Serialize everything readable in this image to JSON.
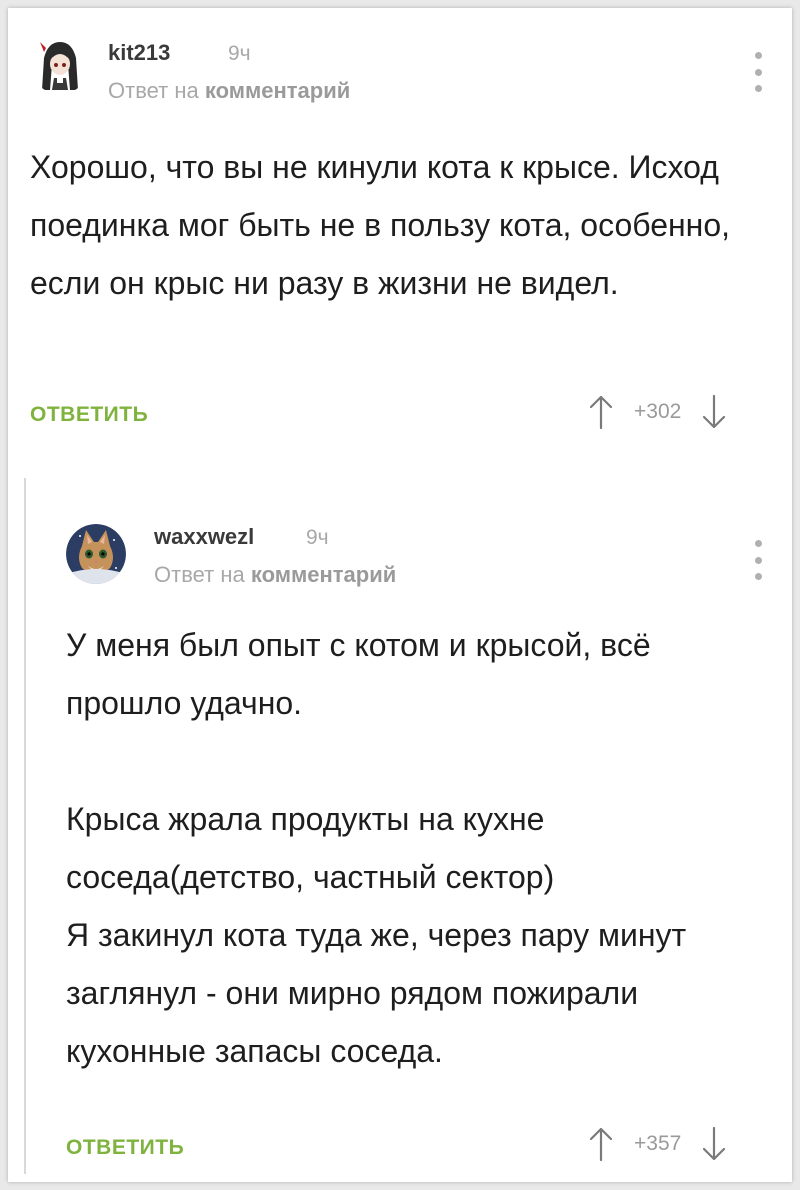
{
  "comments": [
    {
      "username": "kit213",
      "time": "9ч",
      "reply_prefix": "Ответ на",
      "reply_target": "комментарий",
      "paragraphs": [
        "Хорошо, что вы не кинули кота к крысе. Исход поединка мог быть не в пользу кота, особенно, если он крыс ни разу в жизни не видел."
      ],
      "reply_label": "ОТВЕТИТЬ",
      "score": "+302",
      "avatar_icon": "anime-girl-avatar"
    },
    {
      "username": "waxxwezl",
      "time": "9ч",
      "reply_prefix": "Ответ на",
      "reply_target": "комментарий",
      "paragraphs": [
        "У меня был опыт с котом и крысой, всё прошло удачно.",
        "Крыса жрала продукты на кухне соседа(детство, частный сектор)\nЯ закинул кота туда же, через пару минут заглянул - они мирно рядом пожирали кухонные запасы соседа."
      ],
      "reply_label": "ОТВЕТИТЬ",
      "score": "+357",
      "avatar_icon": "cat-in-space-avatar"
    }
  ],
  "colors": {
    "accent": "#7fb33e",
    "muted": "#a8a8a8",
    "text": "#1e1e1e"
  },
  "icons": [
    "more-vertical-icon",
    "upvote-arrow-icon",
    "downvote-arrow-icon"
  ]
}
